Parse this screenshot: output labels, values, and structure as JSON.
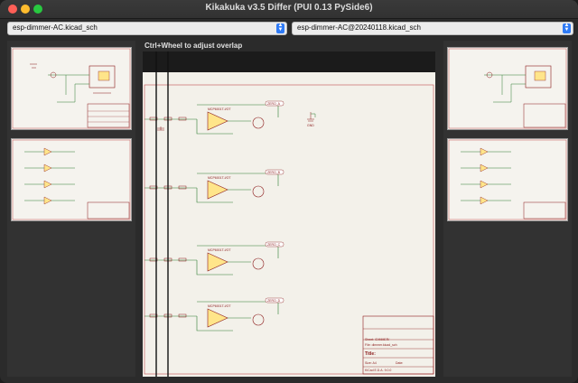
{
  "window": {
    "title": "Kikakuka v3.5 Differ (PUI 0.13 PySide6)"
  },
  "left_select": {
    "value": "esp-dimmer-AC.kicad_sch"
  },
  "right_select": {
    "value": "esp-dimmer-AC@20240118.kicad_sch"
  },
  "hint": "Ctrl+Wheel to adjust overlap",
  "schematic": {
    "title_block": {
      "sheet": "Sheet: /DIMMER/",
      "file": "File: dimmer.kicad_sch",
      "title": "Title:",
      "size": "Size: A4",
      "date": "Date:",
      "kicad": "KiCad E.D.A. 9.0.0",
      "rev": "Rev:",
      "id": "Id: 3/3"
    },
    "net_labels": [
      "ZERO_A",
      "ZERO_B",
      "ZERO_C",
      "ZERO_D"
    ],
    "opamp_label": "MCP6001T-I/OT",
    "gnd_label": "GND"
  },
  "colors": {
    "wire": "#2e7d32",
    "symbol": "#8b1a1a",
    "opamp_fill": "#ffe58a",
    "accent": "#2f7bf6"
  }
}
